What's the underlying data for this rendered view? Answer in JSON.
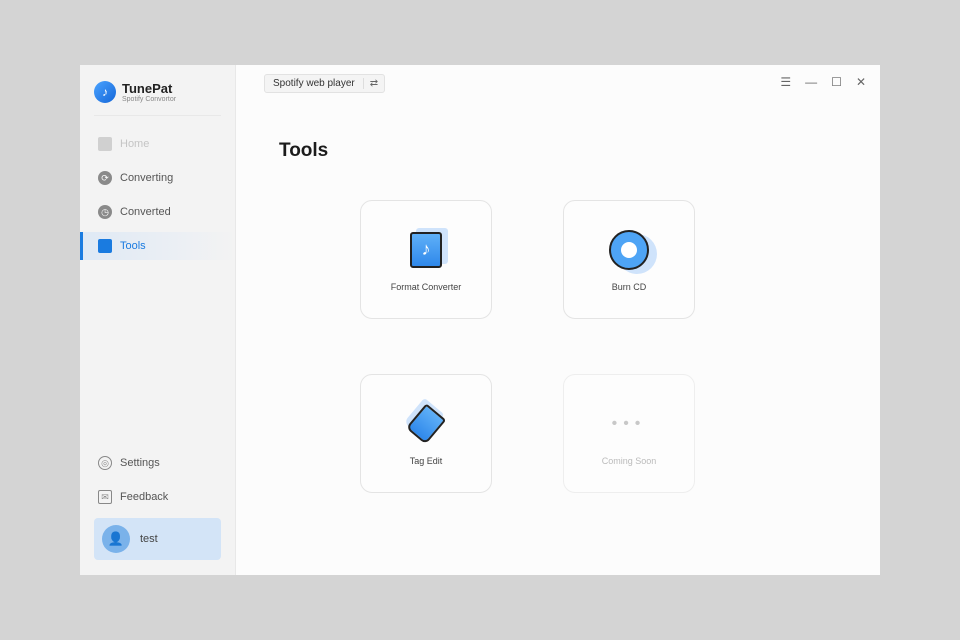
{
  "app": {
    "name": "TunePat",
    "subtitle": "Spotify Convortor"
  },
  "sidebar": {
    "items": [
      {
        "label": "Home"
      },
      {
        "label": "Converting"
      },
      {
        "label": "Converted"
      },
      {
        "label": "Tools"
      }
    ],
    "settings": "Settings",
    "feedback": "Feedback",
    "user": "test"
  },
  "header": {
    "source": "Spotify web player"
  },
  "main": {
    "title": "Tools",
    "tools": [
      {
        "label": "Format Converter"
      },
      {
        "label": "Burn CD"
      },
      {
        "label": "Tag Edit"
      },
      {
        "label": "Coming Soon"
      }
    ]
  },
  "colors": {
    "accent": "#1a7be0"
  }
}
